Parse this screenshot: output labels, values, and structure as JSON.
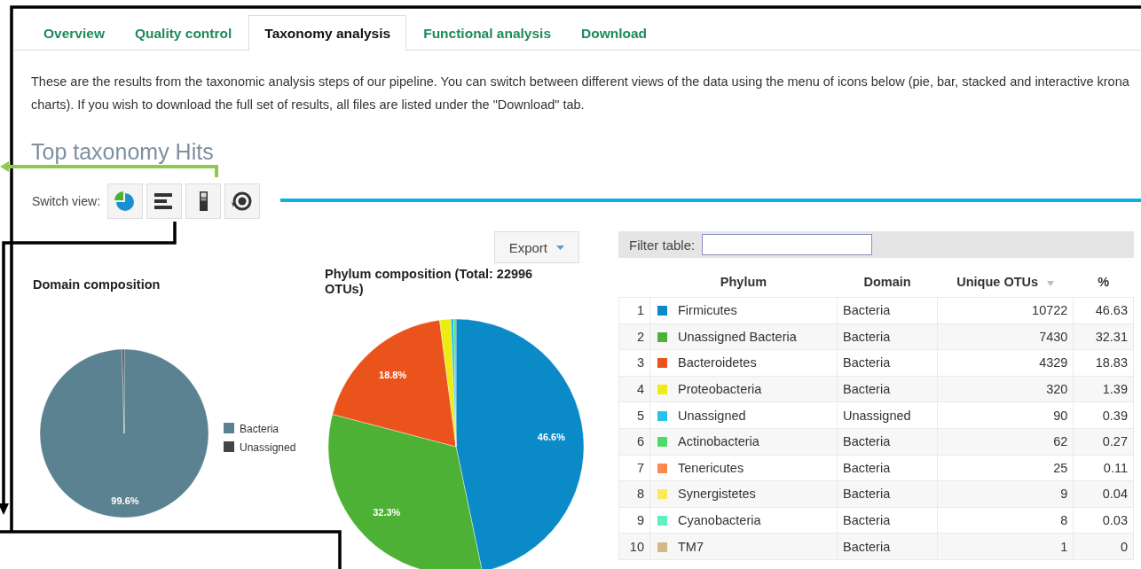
{
  "tabs": [
    {
      "label": "Overview",
      "selected": false
    },
    {
      "label": "Quality control",
      "selected": false
    },
    {
      "label": "Taxonomy analysis",
      "selected": true
    },
    {
      "label": "Functional analysis",
      "selected": false
    },
    {
      "label": "Download",
      "selected": false
    }
  ],
  "intro": "These are the results from the taxonomic analysis steps of our pipeline. You can switch between different views of the data using the menu of icons below (pie, bar, stacked and interactive krona charts). If you wish to download the full set of results, all files are listed under the \"Download\" tab.",
  "heading": "Top taxonomy Hits",
  "switch_view": {
    "label": "Switch view:",
    "buttons": [
      {
        "kind": "pie"
      },
      {
        "kind": "bar"
      },
      {
        "kind": "stacked"
      },
      {
        "kind": "krona"
      }
    ]
  },
  "domain_chart": {
    "title": "Domain composition",
    "chart_data": {
      "type": "pie",
      "categories": [
        "Bacteria",
        "Unassigned"
      ],
      "values": [
        99.6,
        0.4
      ],
      "legend": "right",
      "colors": [
        "#5b8290",
        "#444444"
      ],
      "value_labels": [
        "99.6%",
        null
      ]
    }
  },
  "phylum_chart": {
    "title": "Phylum composition (Total: 22996 OTUs)",
    "export_button": "Export",
    "chart_data": {
      "type": "pie",
      "values": [
        46.63,
        32.31,
        18.83,
        1.39,
        0.39,
        0.27
      ],
      "colors": [
        "#0a8ac6",
        "#4db135",
        "#ea541c",
        "#ecec14",
        "#27c2e8",
        "#4fda69"
      ],
      "value_labels": [
        "46.6%",
        "32.3%",
        "18.8%",
        null,
        null,
        null
      ]
    }
  },
  "table": {
    "filter_label": "Filter table:",
    "columns": [
      {
        "label": "Phylum",
        "sorted": false
      },
      {
        "label": "Domain",
        "sorted": false
      },
      {
        "label": "Unique OTUs",
        "sorted": true
      },
      {
        "label": "%",
        "sorted": false
      }
    ],
    "rows": [
      {
        "index": "1",
        "color": "#0a8ac6",
        "phylum": "Firmicutes",
        "domain": "Bacteria",
        "otus": "10722",
        "percent": "46.63"
      },
      {
        "index": "2",
        "color": "#4db135",
        "phylum": "Unassigned Bacteria",
        "domain": "Bacteria",
        "otus": "7430",
        "percent": "32.31"
      },
      {
        "index": "3",
        "color": "#ea541c",
        "phylum": "Bacteroidetes",
        "domain": "Bacteria",
        "otus": "4329",
        "percent": "18.83"
      },
      {
        "index": "4",
        "color": "#ecec14",
        "phylum": "Proteobacteria",
        "domain": "Bacteria",
        "otus": "320",
        "percent": "1.39"
      },
      {
        "index": "5",
        "color": "#27c2e8",
        "phylum": "Unassigned",
        "domain": "Unassigned",
        "otus": "90",
        "percent": "0.39"
      },
      {
        "index": "6",
        "color": "#4fda69",
        "phylum": "Actinobacteria",
        "domain": "Bacteria",
        "otus": "62",
        "percent": "0.27"
      },
      {
        "index": "7",
        "color": "#fb8a4f",
        "phylum": "Tenericutes",
        "domain": "Bacteria",
        "otus": "25",
        "percent": "0.11"
      },
      {
        "index": "8",
        "color": "#fbe958",
        "phylum": "Synergistetes",
        "domain": "Bacteria",
        "otus": "9",
        "percent": "0.04"
      },
      {
        "index": "9",
        "color": "#5ef0c0",
        "phylum": "Cyanobacteria",
        "domain": "Bacteria",
        "otus": "8",
        "percent": "0.03"
      },
      {
        "index": "10",
        "color": "#d3b985",
        "phylum": "TM7",
        "domain": "Bacteria",
        "otus": "1",
        "percent": "0"
      }
    ]
  }
}
